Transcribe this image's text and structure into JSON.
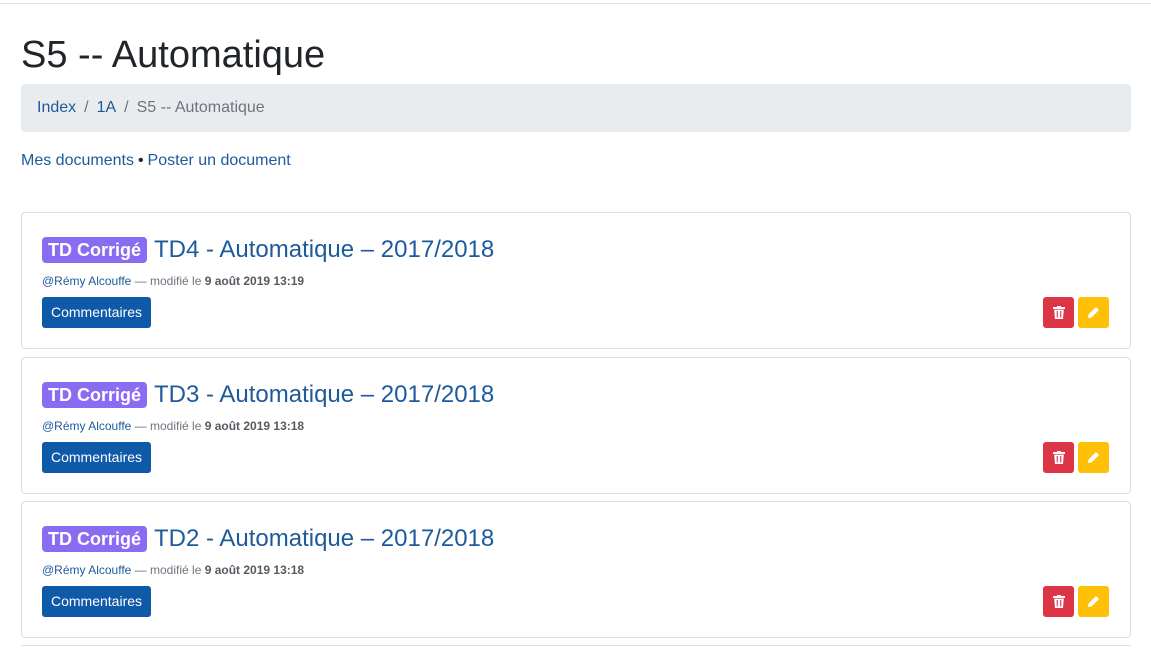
{
  "page": {
    "title": "S5 -- Automatique"
  },
  "breadcrumb": {
    "items": [
      {
        "label": "Index"
      },
      {
        "label": "1A"
      }
    ],
    "separator": "/",
    "active": "S5 -- Automatique"
  },
  "actions": {
    "my_documents": "Mes documents",
    "bullet": "•",
    "post_document": "Poster un document"
  },
  "documents": [
    {
      "badge": "TD Corrigé",
      "title": "TD4 - Automatique – 2017/2018",
      "author": "@Rémy Alcouffe",
      "modified_prefix": " — modifié le ",
      "modified_date": "9 août 2019 13:19",
      "comments_label": "Commentaires"
    },
    {
      "badge": "TD Corrigé",
      "title": "TD3 - Automatique – 2017/2018",
      "author": "@Rémy Alcouffe",
      "modified_prefix": " — modifié le ",
      "modified_date": "9 août 2019 13:18",
      "comments_label": "Commentaires"
    },
    {
      "badge": "TD Corrigé",
      "title": "TD2 - Automatique – 2017/2018",
      "author": "@Rémy Alcouffe",
      "modified_prefix": " — modifié le ",
      "modified_date": "9 août 2019 13:18",
      "comments_label": "Commentaires"
    }
  ],
  "icons": {
    "delete": "trash-icon",
    "edit": "pencil-icon"
  },
  "colors": {
    "link": "#1d5a9c",
    "badge": "#8a6cf3",
    "primary": "#0f5aa8",
    "danger": "#dc3545",
    "warning": "#ffc107",
    "breadcrumb_bg": "#e9ecef"
  }
}
